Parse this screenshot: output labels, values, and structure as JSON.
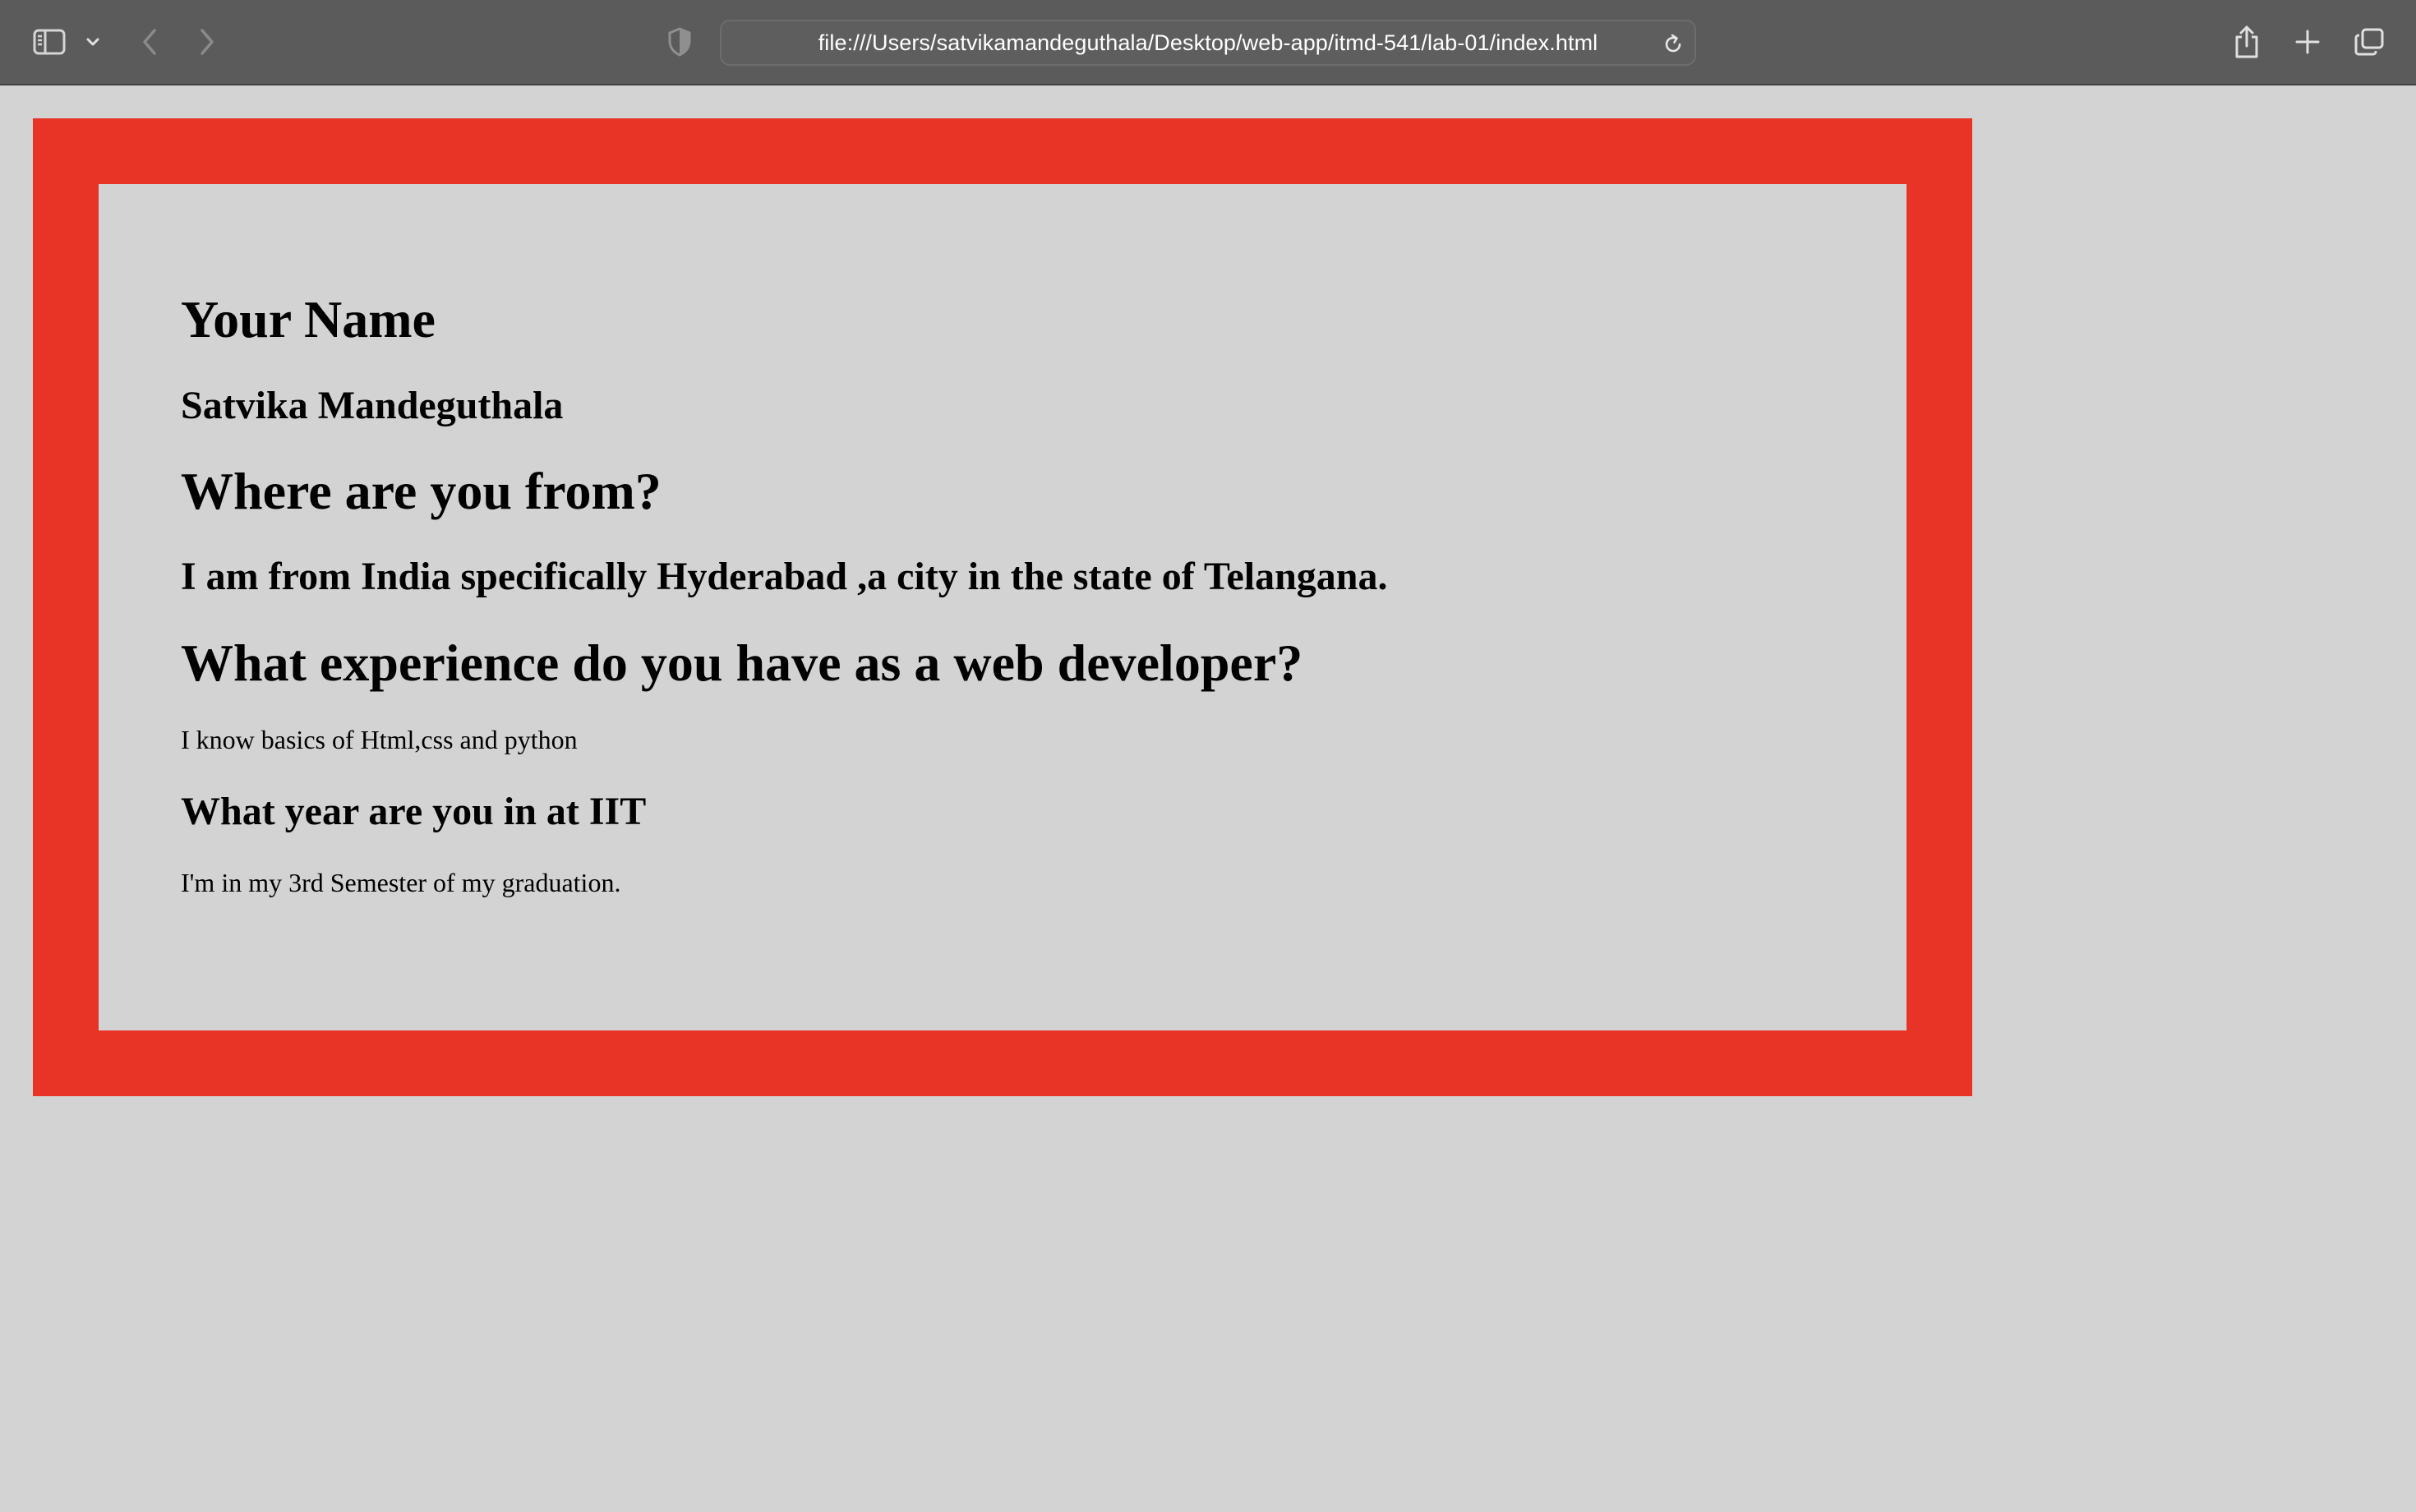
{
  "browser": {
    "url": "file:///Users/satvikamandeguthala/Desktop/web-app/itmd-541/lab-01/index.html",
    "icons": {
      "sidebar": "sidebar-toggle-icon",
      "sidebar_menu": "chevron-down-icon",
      "back": "chevron-left-icon",
      "forward": "chevron-right-icon",
      "privacy": "shield-icon",
      "reload": "reload-icon",
      "share": "share-icon",
      "new_tab": "plus-icon",
      "tab_overview": "tabs-icon"
    }
  },
  "page": {
    "colors": {
      "frame": "#e83427",
      "background": "#d3d3d3",
      "text": "#000000"
    },
    "name_heading": "Your Name",
    "name_value": "Satvika Mandeguthala",
    "from_heading": "Where are you from?",
    "from_value": "I am from India specifically Hyderabad ,a city in the state of Telangana.",
    "experience_heading": "What experience do you have as a web developer?",
    "experience_value": "I know basics of Html,css and python",
    "year_heading": "What year are you in at IIT",
    "year_value": "I'm in my 3rd Semester of my graduation."
  }
}
